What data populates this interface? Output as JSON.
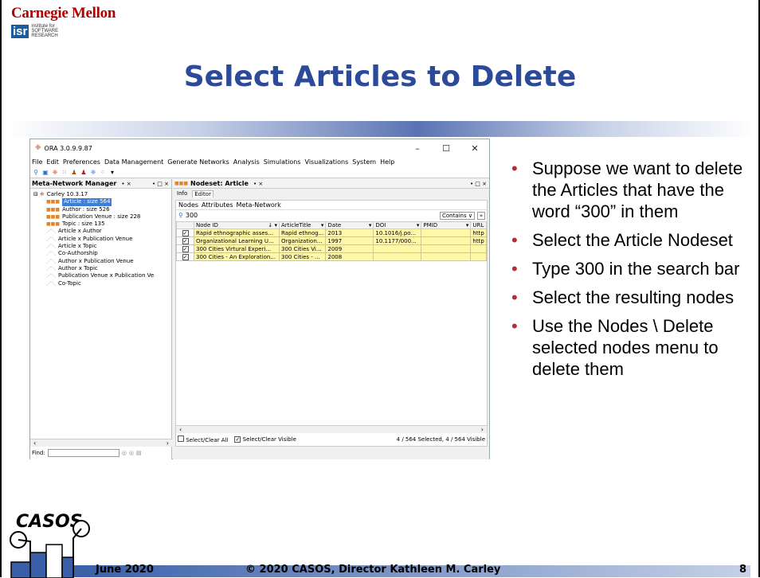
{
  "header": {
    "org": "Carnegie Mellon",
    "isr_logo": "isr",
    "isr_tagline": [
      "institute for",
      "SOFTWARE",
      "RESEARCH"
    ]
  },
  "slide": {
    "title": "Select Articles to Delete",
    "bullets": [
      "Suppose we want to delete the Articles that have the word “300” in them",
      "Select the Article Nodeset",
      "Type 300 in the search bar",
      "Select the resulting nodes",
      "Use the Nodes \\ Delete selected nodes menu to delete them"
    ]
  },
  "app": {
    "title": "ORA 3.0.9.9.87",
    "window_controls": [
      "–",
      "☐",
      "✕"
    ],
    "menu": [
      "File",
      "Edit",
      "Preferences",
      "Data Management",
      "Generate Networks",
      "Analysis",
      "Simulations",
      "Visualizations",
      "System",
      "Help"
    ],
    "left_panel": {
      "title": "Meta-Network Manager",
      "title_ctl": "• ×",
      "win_ctl": "• □ ×",
      "root": "Carley 10.3.17",
      "items": [
        {
          "label": "Article : size 564",
          "kind": "node",
          "selected": true
        },
        {
          "label": "Author : size 526",
          "kind": "node"
        },
        {
          "label": "Publication Venue : size 228",
          "kind": "node"
        },
        {
          "label": "Topic : size 135",
          "kind": "node"
        },
        {
          "label": "Article x Author",
          "kind": "link"
        },
        {
          "label": "Article x Publication Venue",
          "kind": "link"
        },
        {
          "label": "Article x Topic",
          "kind": "link"
        },
        {
          "label": "Co-Authorship",
          "kind": "link"
        },
        {
          "label": "Author x Publication Venue",
          "kind": "link"
        },
        {
          "label": "Author x Topic",
          "kind": "link"
        },
        {
          "label": "Publication Venue x Publication Ve",
          "kind": "link"
        },
        {
          "label": "Co-Topic",
          "kind": "link"
        }
      ],
      "find_label": "Find:"
    },
    "right_panel": {
      "title": "Nodeset: Article",
      "title_ctl": "• ×",
      "win_ctl": "• □ ×",
      "tabs": [
        "Info",
        "Editor"
      ],
      "subtabs": [
        "Nodes",
        "Attributes",
        "Meta-Network"
      ],
      "search_value": "300",
      "search_mode": "Contains",
      "columns": [
        "",
        "Node ID",
        "ArticleTitle",
        "Date",
        "DOI",
        "PMID",
        "URL"
      ],
      "rows": [
        [
          "Rapid ethnographic asses...",
          "Rapid ethnog...",
          "2013",
          "10.1016/j.po...",
          "",
          "http"
        ],
        [
          "Organizational Learning U...",
          "Organization...",
          "1997",
          "10.1177/000...",
          "",
          "http"
        ],
        [
          "300 Cities Virtural Experi...",
          "300 Cities Vi...",
          "2009",
          "",
          "",
          ""
        ],
        [
          "300 Cities - An Exploration...",
          "300 Cities - ...",
          "2008",
          "",
          "",
          ""
        ]
      ],
      "select_all": "Select/Clear All",
      "select_visible": "Select/Clear Visible",
      "status": "4 / 564 Selected, 4 / 564 Visible"
    }
  },
  "footer": {
    "date": "June 2020",
    "copyright": "© 2020 CASOS, Director Kathleen M. Carley",
    "page": "8",
    "logo_text": "CASOS"
  }
}
